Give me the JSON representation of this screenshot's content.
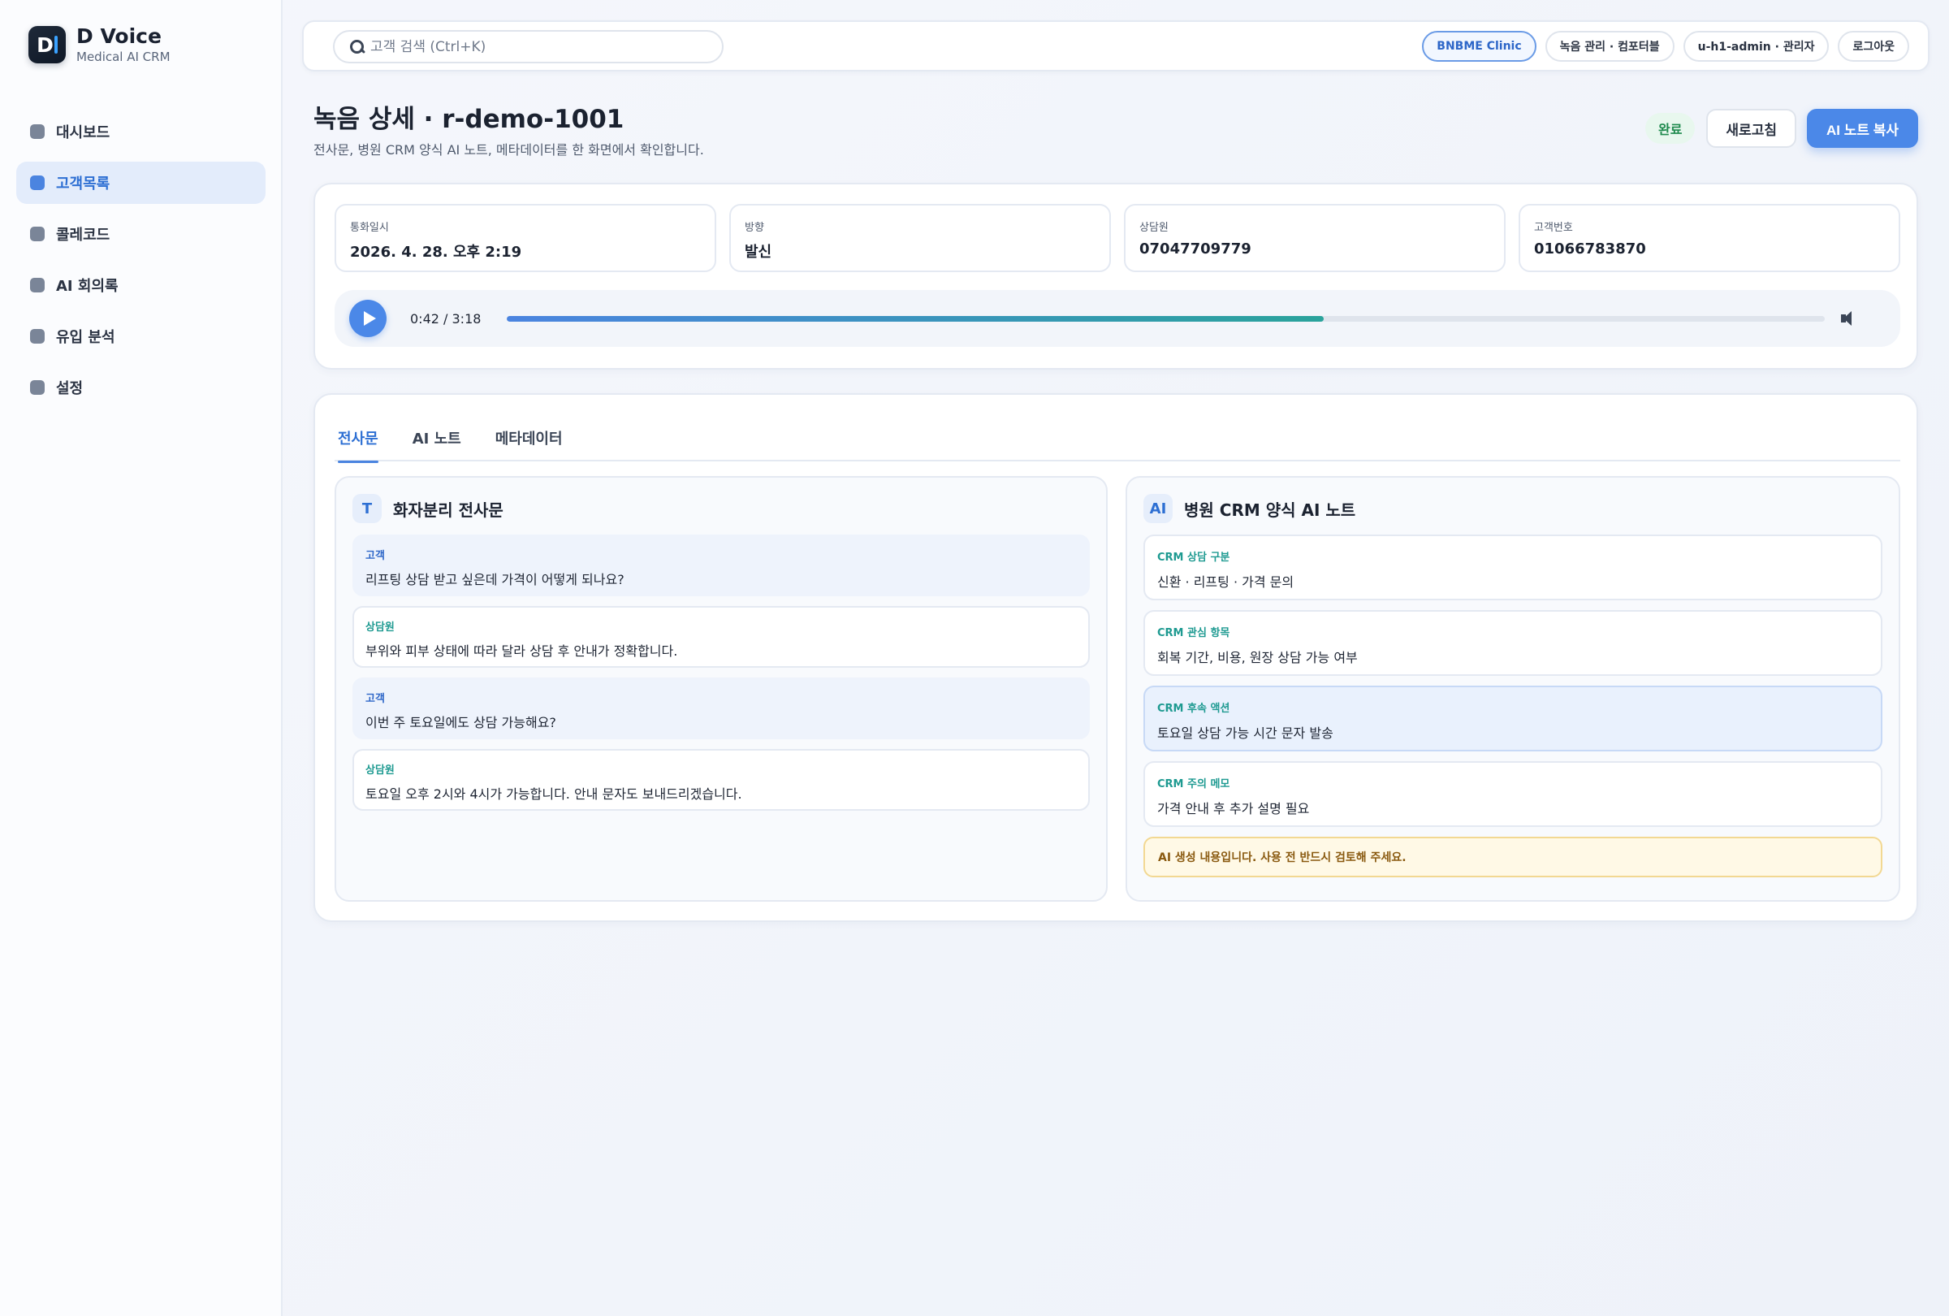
{
  "app": {
    "name": "D Voice",
    "subtitle": "Medical AI CRM",
    "logo_text": "D"
  },
  "sidebar": {
    "items": [
      {
        "label": "대시보드",
        "active": false
      },
      {
        "label": "고객목록",
        "active": true
      },
      {
        "label": "콜레코드",
        "active": false
      },
      {
        "label": "AI 회의록",
        "active": false
      },
      {
        "label": "유입 분석",
        "active": false
      },
      {
        "label": "설정",
        "active": false
      }
    ]
  },
  "topbar": {
    "search_placeholder": "고객 검색 (Ctrl+K)",
    "clinic": "BNBME Clinic",
    "role_chip": "녹음 관리 · 컴포터블",
    "user_chip": "u-h1-admin · 관리자",
    "logout": "로그아웃"
  },
  "header": {
    "title": "녹음 상세 · r-demo-1001",
    "subtitle": "전사문, 병원 CRM 양식 AI 노트, 메타데이터를 한 화면에서 확인합니다.",
    "status": "완료",
    "refresh": "새로고침",
    "copy_note": "AI 노트 복사"
  },
  "info": {
    "call_time_label": "통화일시",
    "call_time": "2026. 4. 28. 오후 2:19",
    "direction_label": "방향",
    "direction": "발신",
    "agent_label": "상담원",
    "agent": "07047709779",
    "customer_label": "고객번호",
    "customer": "01066783870"
  },
  "player": {
    "time": "0:42 / 3:18",
    "progress": 0.62
  },
  "tabs": [
    {
      "label": "전사문",
      "active": true
    },
    {
      "label": "AI 노트",
      "active": false
    },
    {
      "label": "메타데이터",
      "active": false
    }
  ],
  "transcript": {
    "icon": "T",
    "title": "화자분리 전사문",
    "messages": [
      {
        "speaker": "고객",
        "text": "리프팅 상담 받고 싶은데 가격이 어떻게 되나요?"
      },
      {
        "speaker": "상담원",
        "text": "부위와 피부 상태에 따라 달라 상담 후 안내가 정확합니다."
      },
      {
        "speaker": "고객",
        "text": "이번 주 토요일에도 상담 가능해요?"
      },
      {
        "speaker": "상담원",
        "text": "토요일 오후 2시와 4시가 가능합니다. 안내 문자도 보내드리겠습니다."
      }
    ]
  },
  "ai_note": {
    "icon": "AI",
    "title": "병원 CRM 양식 AI 노트",
    "items": [
      {
        "label": "CRM 상담 구분",
        "text": "신환 · 리프팅 · 가격 문의"
      },
      {
        "label": "CRM 관심 항목",
        "text": "회복 기간, 비용, 원장 상담 가능 여부"
      },
      {
        "label": "CRM 후속 액션",
        "text": "토요일 상담 가능 시간 문자 발송"
      },
      {
        "label": "CRM 주의 메모",
        "text": "가격 안내 후 추가 설명 필요"
      }
    ],
    "warning": "AI 생성 내용입니다. 사용 전 반드시 검토해 주세요."
  },
  "colors": {
    "accent": "#4b88e8",
    "teal": "#1e9a91",
    "status_green": "#1f8a4e"
  }
}
